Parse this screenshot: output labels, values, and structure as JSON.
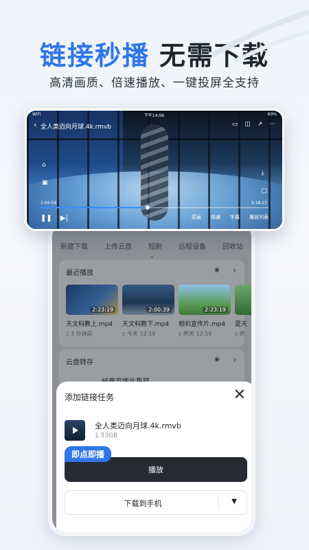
{
  "headline": {
    "blue": "链接秒播",
    "dark": "无需下载"
  },
  "subline": "高清画质、倍速播放、一键投屏全支持",
  "colors": {
    "accent": "#2f76e8",
    "dark_button": "#262a33"
  },
  "player": {
    "status_left": "WiFi",
    "status_center": "下午14:06",
    "status_right": "60%",
    "title": "全人类迈向月球.4k.rmvb",
    "top_icons": [
      "tv-cast-icon",
      "pip-icon",
      "share-icon",
      "more-icon"
    ],
    "side_icons": [
      "lock-icon",
      "screenshot-icon"
    ],
    "right_icons": [
      "download-icon",
      "record-icon"
    ],
    "time_elapsed": "1:04:54",
    "time_total": "2:18:23",
    "progress_fraction": 0.47,
    "bottom_actions": [
      "原画",
      "倍速",
      "字幕",
      "播放列表"
    ]
  },
  "app": {
    "tabs": [
      "新建下载",
      "上传云盘",
      "短剧",
      "远程设备",
      "回收站"
    ],
    "recent": {
      "title": "最近播放",
      "items": [
        {
          "duration": "2:23:19",
          "name": "天文科教上.mp4",
          "meta": "3 分钟前"
        },
        {
          "duration": "2:00:39",
          "name": "天文科教下.mp4",
          "meta": "今天 12:16"
        },
        {
          "duration": "2:23:19",
          "name": "相机宣传片.mp4",
          "meta": "昨天 12:16"
        },
        {
          "duration": "",
          "name": "夏天",
          "meta": "昨"
        }
      ]
    },
    "cloud": {
      "title": "云盘转存",
      "subtitle": "经典宣传片集锦"
    }
  },
  "sheet": {
    "title": "添加链接任务",
    "file_name": "全人类迈向月球.4k.rmvb",
    "file_size": "1.53GB",
    "badge": "即点即播",
    "play_label": "播放",
    "download_label": "下载到手机"
  }
}
